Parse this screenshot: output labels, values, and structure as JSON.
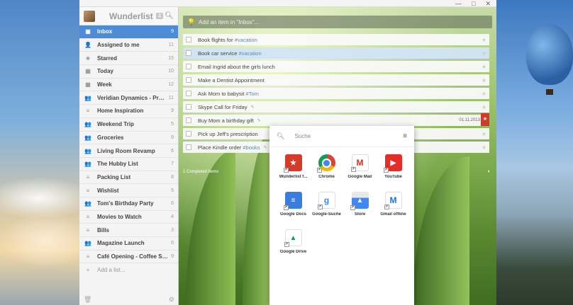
{
  "window": {
    "minimize": "—",
    "maximize": "□",
    "close": "✕"
  },
  "sidebar": {
    "app_title": "Wunderlist",
    "badge": "4",
    "items": [
      {
        "label": "Inbox",
        "count": "9",
        "icon": "inbox-icon",
        "glyph": "▣",
        "active": true
      },
      {
        "label": "Assigned to me",
        "count": "11",
        "icon": "assigned-icon",
        "glyph": "👤",
        "active": false
      },
      {
        "label": "Starred",
        "count": "15",
        "icon": "star-icon",
        "glyph": "★",
        "active": false
      },
      {
        "label": "Today",
        "count": "10",
        "icon": "calendar-icon",
        "glyph": "▦",
        "active": false
      },
      {
        "label": "Week",
        "count": "12",
        "icon": "calendar-icon",
        "glyph": "▦",
        "active": false
      },
      {
        "label": "Veridian Dynamics - Product...",
        "count": "11",
        "icon": "shared-list-icon",
        "glyph": "👥",
        "active": false
      },
      {
        "label": "Home Inspiration",
        "count": "9",
        "icon": "list-icon",
        "glyph": "≡",
        "active": false
      },
      {
        "label": "Weekend Trip",
        "count": "5",
        "icon": "shared-list-icon",
        "glyph": "👥",
        "active": false
      },
      {
        "label": "Groceries",
        "count": "9",
        "icon": "shared-list-icon",
        "glyph": "👥",
        "active": false
      },
      {
        "label": "Living Room Revamp",
        "count": "6",
        "icon": "shared-list-icon",
        "glyph": "👥",
        "active": false
      },
      {
        "label": "The Hubby List",
        "count": "7",
        "icon": "shared-list-icon",
        "glyph": "👥",
        "active": false
      },
      {
        "label": "Packing List",
        "count": "8",
        "icon": "list-icon",
        "glyph": "≡",
        "active": false
      },
      {
        "label": "Wishlist",
        "count": "5",
        "icon": "list-icon",
        "glyph": "≡",
        "active": false
      },
      {
        "label": "Tom's Birthday Party",
        "count": "6",
        "icon": "shared-list-icon",
        "glyph": "👥",
        "active": false
      },
      {
        "label": "Movies to Watch",
        "count": "4",
        "icon": "list-icon",
        "glyph": "≡",
        "active": false
      },
      {
        "label": "Bills",
        "count": "3",
        "icon": "list-icon",
        "glyph": "≡",
        "active": false
      },
      {
        "label": "Magazine Launch",
        "count": "6",
        "icon": "shared-list-icon",
        "glyph": "👥",
        "active": false
      },
      {
        "label": "Café Opening - Coffee Supr...",
        "count": "9",
        "icon": "list-icon",
        "glyph": "≡",
        "active": false
      }
    ],
    "add_list": "Add a list..."
  },
  "main": {
    "add_placeholder": "Add an item in \"Inbox\"...",
    "tasks": [
      {
        "title": "Book flights for ",
        "tag": "#vacation",
        "selected": false
      },
      {
        "title": "Book car service ",
        "tag": "#vacation",
        "selected": true
      },
      {
        "title": "Email Ingrid about the girls lunch",
        "tag": "",
        "selected": false
      },
      {
        "title": "Make a Dentist Appointment",
        "tag": "",
        "selected": false
      },
      {
        "title": "Ask Mom to babysit ",
        "tag": "#Tom",
        "selected": false
      },
      {
        "title": "Skype Call for Friday",
        "tag": "",
        "note": true,
        "selected": false
      },
      {
        "title": "Buy Mom a birthday gift",
        "tag": "",
        "note": true,
        "date": "01.11.2013",
        "flagged": true,
        "selected": false
      },
      {
        "title": "Pick up Jeff's prescription",
        "tag": "",
        "selected": false
      },
      {
        "title": "Place Kindle order ",
        "tag": "#books",
        "note": true,
        "selected": false
      }
    ],
    "completed_label": "1 Completed Items"
  },
  "launcher": {
    "search_placeholder": "Suche",
    "apps": [
      {
        "label": "Wunderlist f...",
        "icon": "wunderlist-icon",
        "glyph": "★",
        "cls": "ic-wunderlist"
      },
      {
        "label": "Chrome",
        "icon": "chrome-icon",
        "glyph": "",
        "cls": "ic-chrome"
      },
      {
        "label": "Google Mail",
        "icon": "gmail-icon",
        "glyph": "M",
        "cls": "ic-gmail"
      },
      {
        "label": "YouTube",
        "icon": "youtube-icon",
        "glyph": "▶",
        "cls": "ic-youtube"
      },
      {
        "label": "Google Docs",
        "icon": "docs-icon",
        "glyph": "≡",
        "cls": "ic-docs"
      },
      {
        "label": "Google-Suche",
        "icon": "google-search-icon",
        "glyph": "g",
        "cls": "ic-gsearch"
      },
      {
        "label": "Store",
        "icon": "store-icon",
        "glyph": "▲",
        "cls": "ic-store"
      },
      {
        "label": "Gmail offline",
        "icon": "gmail-offline-icon",
        "glyph": "M",
        "cls": "ic-gmailoff"
      },
      {
        "label": "Google Drive",
        "icon": "drive-icon",
        "glyph": "▲",
        "cls": "ic-drive"
      }
    ]
  },
  "colors": {
    "accent": "#4d8bd6",
    "flag": "#d03a2b"
  }
}
